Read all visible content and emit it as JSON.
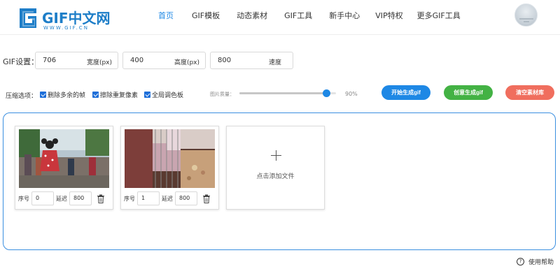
{
  "header": {
    "logo_title": "GIF中文网",
    "logo_sub": "WWW.GIF.CN",
    "nav": [
      "首页",
      "GIF模板",
      "动态素材",
      "GIF工具",
      "新手中心",
      "VIP特权",
      "更多GIF工具"
    ],
    "active_nav": 0
  },
  "settings": {
    "label": "GIF设置：",
    "width": {
      "value": "706",
      "unit": "宽度(px)"
    },
    "height": {
      "value": "400",
      "unit": "高度(px)"
    },
    "speed": {
      "value": "800",
      "unit": "速度"
    }
  },
  "options": {
    "label": "压缩选项：",
    "checkboxes": [
      {
        "label": "删除多余的帧",
        "checked": true
      },
      {
        "label": "擦除重复像素",
        "checked": true
      },
      {
        "label": "全局调色板",
        "checked": true
      }
    ],
    "quality_label": "图片质量：",
    "quality_percent": 90,
    "quality_text": "90%"
  },
  "actions": {
    "start": "开始生成gif",
    "create": "创意生成gif",
    "clear": "清空素材库"
  },
  "frames": [
    {
      "index_label": "序号",
      "index": "0",
      "delay_label": "延迟",
      "delay": "800"
    },
    {
      "index_label": "序号",
      "index": "1",
      "delay_label": "延迟",
      "delay": "800"
    }
  ],
  "add_file": "点击添加文件",
  "help": "使用帮助",
  "colors": {
    "accent": "#1e88e5",
    "green": "#43b244",
    "red": "#f06e5e",
    "logo": "#1e7ec8"
  }
}
